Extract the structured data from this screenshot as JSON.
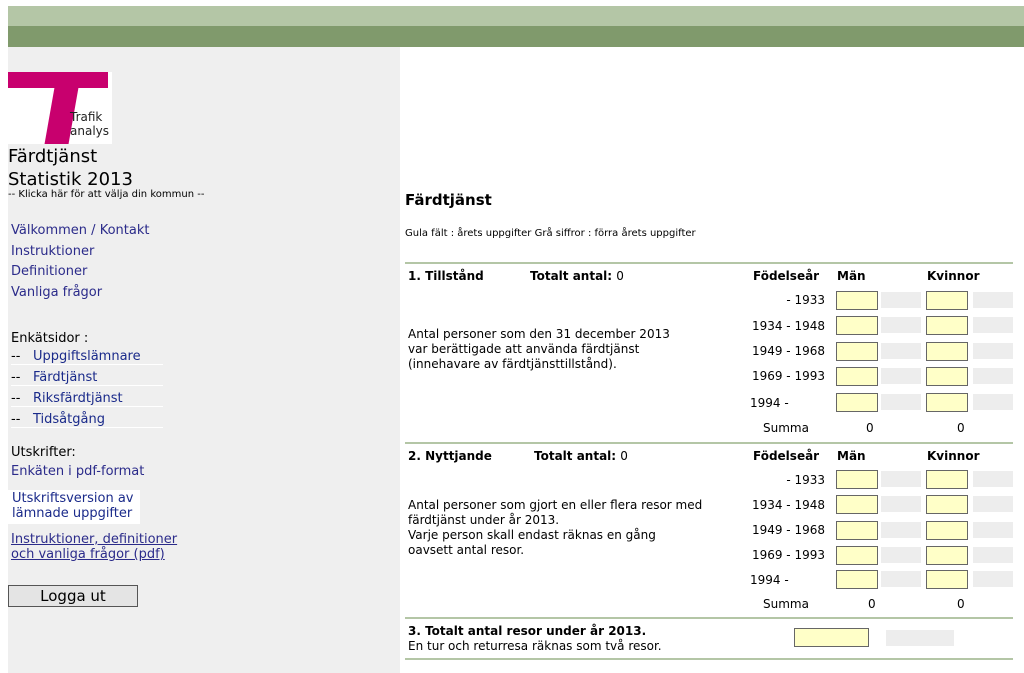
{
  "logo": {
    "line1": "Trafik",
    "line2": "analys"
  },
  "sidebar": {
    "title_line1": "Färdtjänst",
    "title_line2": "Statistik 2013",
    "choose_municipality": "-- Klicka här för att välja din kommun --",
    "nav": [
      "Välkommen / Kontakt",
      "Instruktioner",
      "Definitioner",
      "Vanliga frågor"
    ],
    "survey_label": "Enkätsidor :",
    "survey_pages": [
      {
        "dash": "--",
        "label": "Uppgiftslämnare"
      },
      {
        "dash": "--",
        "label": "Färdtjänst"
      },
      {
        "dash": "--",
        "label": "Riksfärdtjänst"
      },
      {
        "dash": "--",
        "label": "Tidsåtgång"
      }
    ],
    "prints_label": "Utskrifter:",
    "pdf_survey": "Enkäten i pdf-format",
    "print_version_line1": "Utskriftsversion av",
    "print_version_line2": "lämnade uppgifter",
    "pdf_docs_line1": "Instruktioner, definitioner",
    "pdf_docs_line2": "och vanliga frågor (pdf)",
    "logout": "Logga ut"
  },
  "main": {
    "title": "Färdtjänst",
    "legend": "Gula fält : årets uppgifter  Grå siffror : förra årets uppgifter",
    "columns": {
      "birth_year": "Födelseår",
      "men": "Män",
      "women": "Kvinnor"
    },
    "years": [
      "- 1933",
      "1934 - 1948",
      "1949 - 1968",
      "1969 - 1993",
      "1994 -"
    ],
    "sum_label": "Summa",
    "section1": {
      "heading": "1. Tillstånd",
      "total_label": "Totalt  antal:",
      "total_value": "0",
      "desc": [
        "Antal personer som den 31 december 2013",
        "var berättigade att använda färdtjänst",
        "(innehavare av färdtjänsttillstånd)."
      ],
      "sum_men": "0",
      "sum_women": "0"
    },
    "section2": {
      "heading": "2. Nyttjande",
      "total_label": "Totalt antal:",
      "total_value": "0",
      "desc": [
        "Antal personer som gjort en eller flera resor med",
        "färdtjänst under år 2013.",
        "Varje person skall endast räknas en gång",
        "oavsett antal resor."
      ],
      "sum_men": "0",
      "sum_women": "0"
    },
    "section3": {
      "heading": "3. Totalt antal resor under år 2013.",
      "desc": "En tur och returresa räknas som två resor."
    }
  }
}
